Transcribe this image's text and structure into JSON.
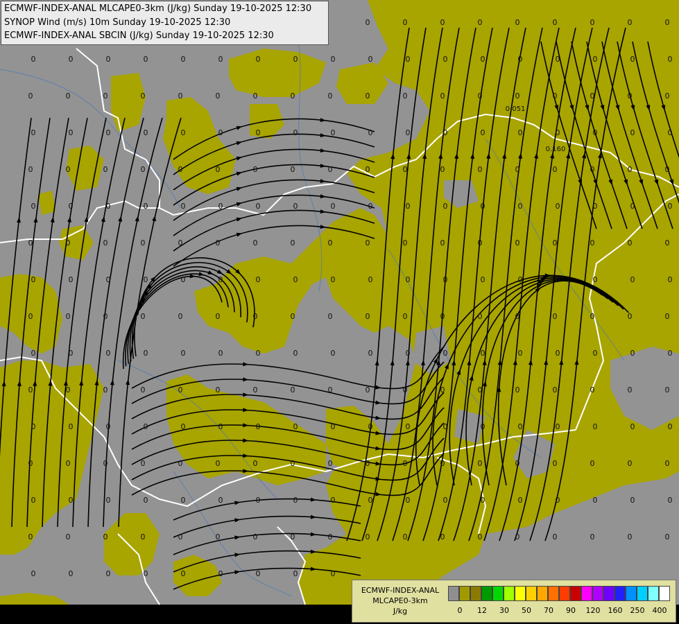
{
  "header": {
    "lines": [
      "ECMWF-INDEX-ANAL MLCAPE0-3km (J/kg) Sunday 19-10-2025 12:30",
      "SYNOP Wind (m/s) 10m Sunday 19-10-2025 12:30",
      "ECMWF-INDEX-ANAL SBCIN (J/kg) Sunday 19-10-2025 12:30"
    ]
  },
  "map": {
    "background_color": "#939393",
    "cape_fill_color": "#a8a400",
    "streamline_color": "#000000",
    "border_color": "#ffffff",
    "river_color": "#4a78b8",
    "grid_value": "0",
    "extra_values": [
      "0.051",
      "0.160"
    ]
  },
  "legend": {
    "title_line1": "ECMWF-INDEX-ANAL",
    "title_line2": "MLCAPE0-3km",
    "unit": "J/kg",
    "ticks": [
      "0",
      "12",
      "30",
      "50",
      "70",
      "90",
      "120",
      "160",
      "250",
      "400"
    ],
    "colors": [
      "#8f8f8f",
      "#a09a00",
      "#8a7a00",
      "#009a00",
      "#00d800",
      "#a0ff00",
      "#ffff00",
      "#ffd000",
      "#ffa800",
      "#ff7000",
      "#ff3c00",
      "#c80000",
      "#ff00ff",
      "#b000ff",
      "#7000ff",
      "#2020ff",
      "#0090ff",
      "#00d0ff",
      "#80ffff",
      "#ffffff"
    ]
  }
}
